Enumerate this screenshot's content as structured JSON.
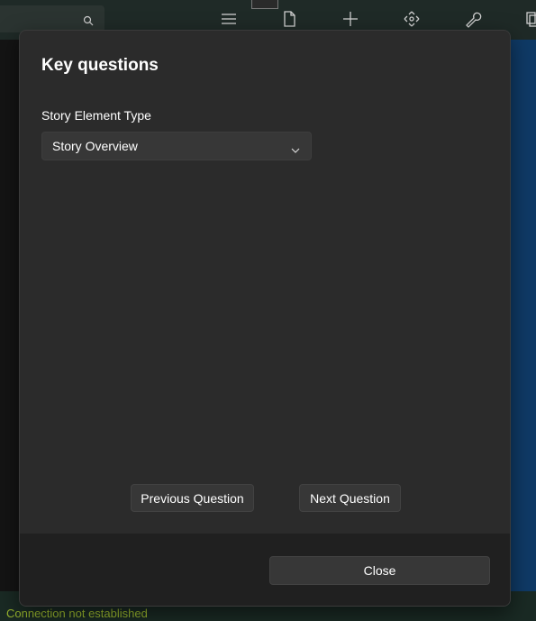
{
  "background": {
    "status_text": "Connection not established",
    "toolbar_icons": [
      "search-icon",
      "hamburger-icon",
      "document-icon",
      "plus-icon",
      "move-icon",
      "wrench-icon",
      "pages-icon"
    ]
  },
  "dialog": {
    "title": "Key questions",
    "field_label": "Story Element Type",
    "select_value": "Story Overview",
    "prev_label": "Previous Question",
    "next_label": "Next Question",
    "close_label": "Close"
  },
  "colors": {
    "dialog_bg": "#2b2b2b",
    "footer_bg": "#202020",
    "status_text": "#9bb82e",
    "accent_blue": "#0f3a66"
  }
}
